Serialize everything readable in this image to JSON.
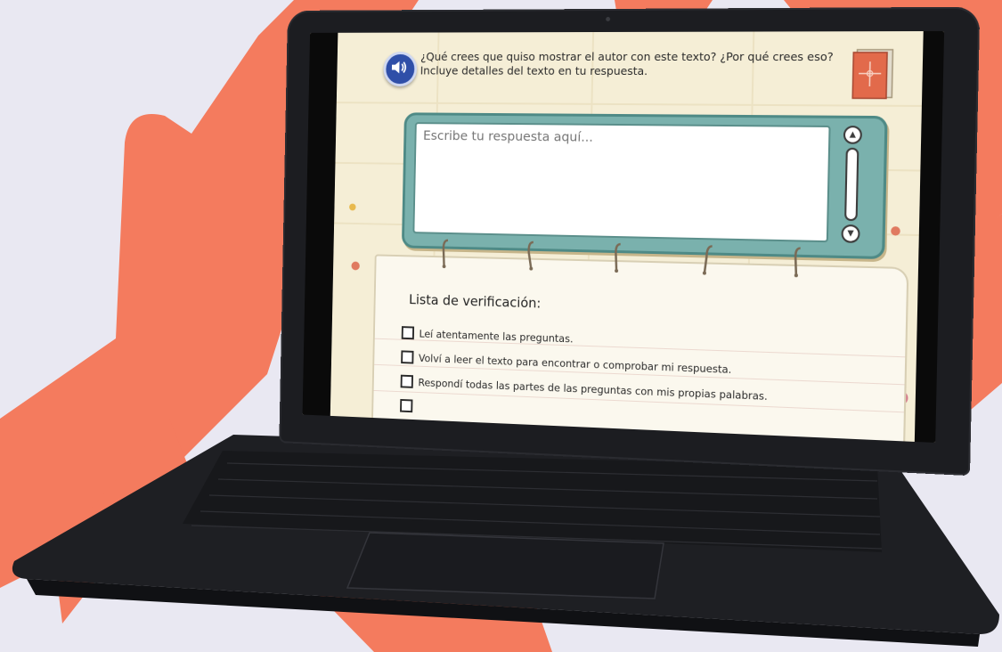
{
  "question": {
    "text": "¿Qué crees que quiso mostrar el autor con este texto? ¿Por qué crees eso? Incluye detalles del texto en tu respuesta."
  },
  "answer": {
    "placeholder": "Escribe tu respuesta aquí..."
  },
  "checklist": {
    "title": "Lista de verificación:",
    "items": [
      "Leí atentamente las preguntas.",
      "Volví a leer el texto para encontrar o comprobar mi respuesta.",
      "Respondí todas las partes de las preguntas con mis propias palabras."
    ]
  },
  "icons": {
    "speaker": "speaker-icon",
    "book": "book-icon",
    "scroll_up": "scroll-up-icon",
    "scroll_down": "scroll-down-icon"
  },
  "colors": {
    "background": "#e9e8f2",
    "brush": "#f47b5e",
    "laptop": "#1c1d21",
    "frame_teal": "#7ab1ad",
    "speaker_blue": "#2f4fa8",
    "screen_bg": "#f5eed6"
  }
}
